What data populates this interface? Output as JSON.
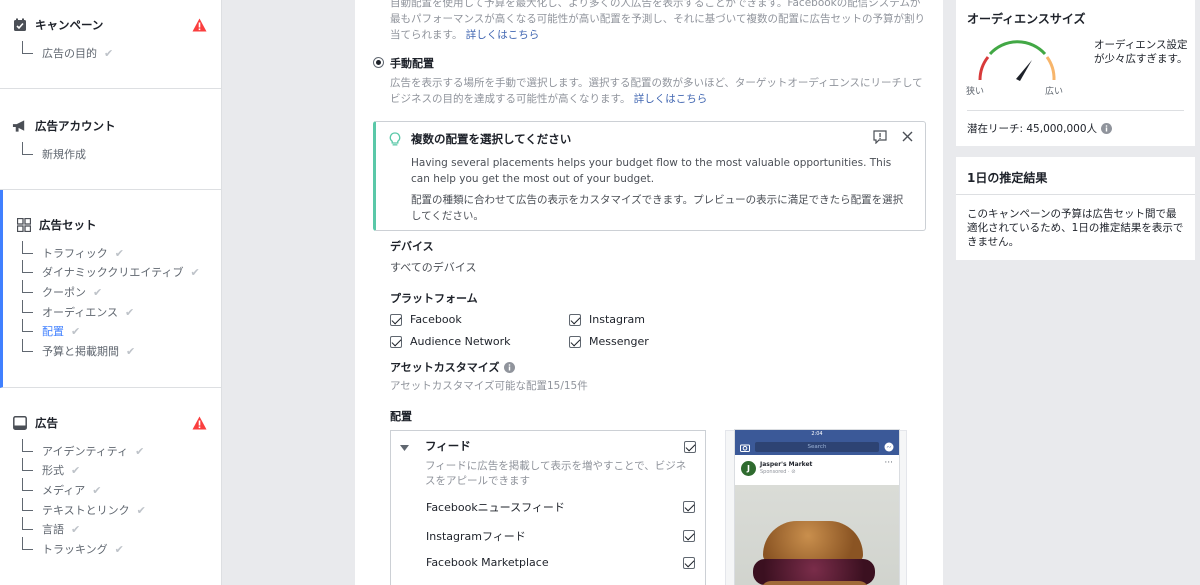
{
  "sidebar": {
    "campaign": {
      "label": "キャンペーン",
      "items": [
        {
          "label": "広告の目的"
        }
      ]
    },
    "account": {
      "label": "広告アカウント",
      "items": [
        {
          "label": "新規作成"
        }
      ]
    },
    "adset": {
      "label": "広告セット",
      "items": [
        {
          "label": "トラフィック"
        },
        {
          "label": "ダイナミッククリエイティブ"
        },
        {
          "label": "クーポン"
        },
        {
          "label": "オーディエンス"
        },
        {
          "label": "配置"
        },
        {
          "label": "予算と掲載期間"
        }
      ]
    },
    "ad": {
      "label": "広告",
      "items": [
        {
          "label": "アイデンティティ"
        },
        {
          "label": "形式"
        },
        {
          "label": "メディア"
        },
        {
          "label": "テキストとリンク"
        },
        {
          "label": "言語"
        },
        {
          "label": "トラッキング"
        }
      ]
    }
  },
  "main": {
    "auto": {
      "desc": "自動配置を使用して予算を最大化し、より多くの人広告を表示することができます。Facebookの配信システムが最もパフォーマンスが高くなる可能性が高い配置を予測し、それに基づいて複数の配置に広告セットの予算が割り当てられます。",
      "link": "詳しくはこちら"
    },
    "manual": {
      "title": "手動配置",
      "desc": "広告を表示する場所を手動で選択します。選択する配置の数が多いほど、ターゲットオーディエンスにリーチしてビジネスの目的を達成する可能性が高くなります。",
      "link": "詳しくはこちら"
    },
    "callout": {
      "title": "複数の配置を選択してください",
      "body1": "Having several placements helps your budget flow to the most valuable opportunities. This can help you get the most out of your budget.",
      "body2": "配置の種類に合わせて広告の表示をカスタマイズできます。プレビューの表示に満足できたら配置を選択してください。"
    },
    "devices": {
      "label": "デバイス",
      "value": "すべてのデバイス"
    },
    "platforms": {
      "label": "プラットフォーム",
      "items": [
        {
          "label": "Facebook",
          "checked": true
        },
        {
          "label": "Instagram",
          "checked": true
        },
        {
          "label": "Audience Network",
          "checked": true
        },
        {
          "label": "Messenger",
          "checked": true
        }
      ]
    },
    "asset": {
      "label": "アセットカスタマイズ",
      "value": "アセットカスタマイズ可能な配置15/15件"
    },
    "placements": {
      "label": "配置",
      "group": "フィード",
      "group_desc": "フィードに広告を掲載して表示を増やすことで、ビジネスをアピールできます",
      "items": [
        {
          "label": "Facebookニュースフィード",
          "checked": true
        },
        {
          "label": "Instagramフィード",
          "checked": true
        },
        {
          "label": "Facebook Marketplace",
          "checked": true
        }
      ]
    },
    "preview": {
      "time": "2:04",
      "search": "Search",
      "page_name": "Jasper's Market",
      "sponsored": "Sponsored · ⊘"
    }
  },
  "right": {
    "audience": {
      "title": "オーディエンスサイズ",
      "desc": "オーディエンス設定が少々広すぎます。",
      "narrow": "狭い",
      "wide": "広い",
      "reach": "潜在リーチ: 45,000,000人"
    },
    "estimate": {
      "title": "1日の推定結果",
      "desc": "このキャンペーンの予算は広告セット間で最適化されているため、1日の推定結果を表示できません。"
    }
  },
  "colors": {
    "accent": "#4080ff",
    "warning": "#fa3e3e",
    "tip": "#5ac8a8",
    "link": "#4267b2"
  }
}
